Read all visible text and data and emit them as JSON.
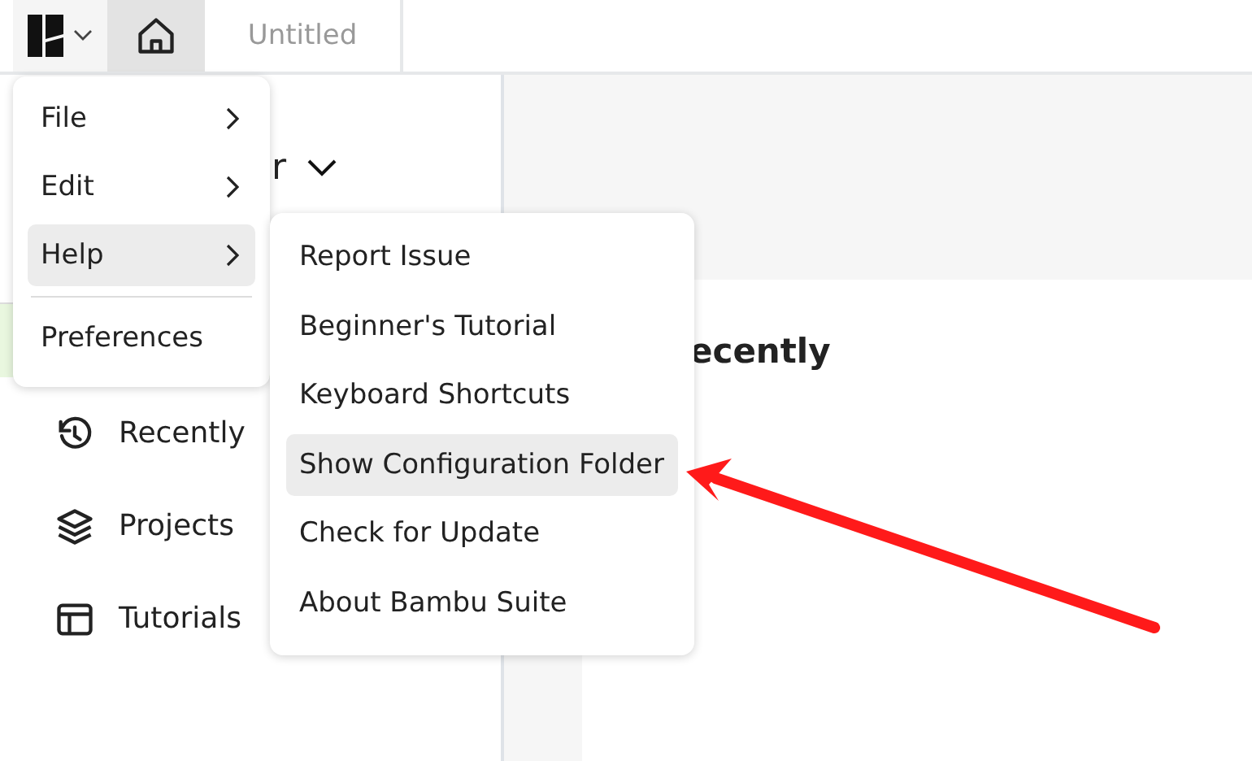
{
  "tabs": [
    {
      "kind": "home",
      "selected": true
    },
    {
      "kind": "document",
      "label": "Untitled",
      "selected": false
    }
  ],
  "sidebar": {
    "header": "r",
    "items": [
      {
        "kind": "history",
        "label": "Recently"
      },
      {
        "kind": "layers",
        "label": "Projects"
      },
      {
        "kind": "layout",
        "label": "Tutorials"
      }
    ]
  },
  "main": {
    "heading": "ecently"
  },
  "app_menu": {
    "items": [
      {
        "kind": "submenu",
        "label": "File",
        "selected": false
      },
      {
        "kind": "submenu",
        "label": "Edit",
        "selected": false
      },
      {
        "kind": "submenu",
        "label": "Help",
        "selected": true
      },
      {
        "kind": "separator"
      },
      {
        "kind": "action",
        "label": "Preferences",
        "selected": false
      }
    ]
  },
  "help_submenu": {
    "items": [
      {
        "label": "Report Issue",
        "selected": false
      },
      {
        "label": "Beginner's Tutorial",
        "selected": false
      },
      {
        "label": "Keyboard Shortcuts",
        "selected": false
      },
      {
        "label": "Show Configuration Folder",
        "selected": true
      },
      {
        "label": "Check for Update",
        "selected": false
      },
      {
        "label": "About Bambu Suite",
        "selected": false
      }
    ]
  }
}
